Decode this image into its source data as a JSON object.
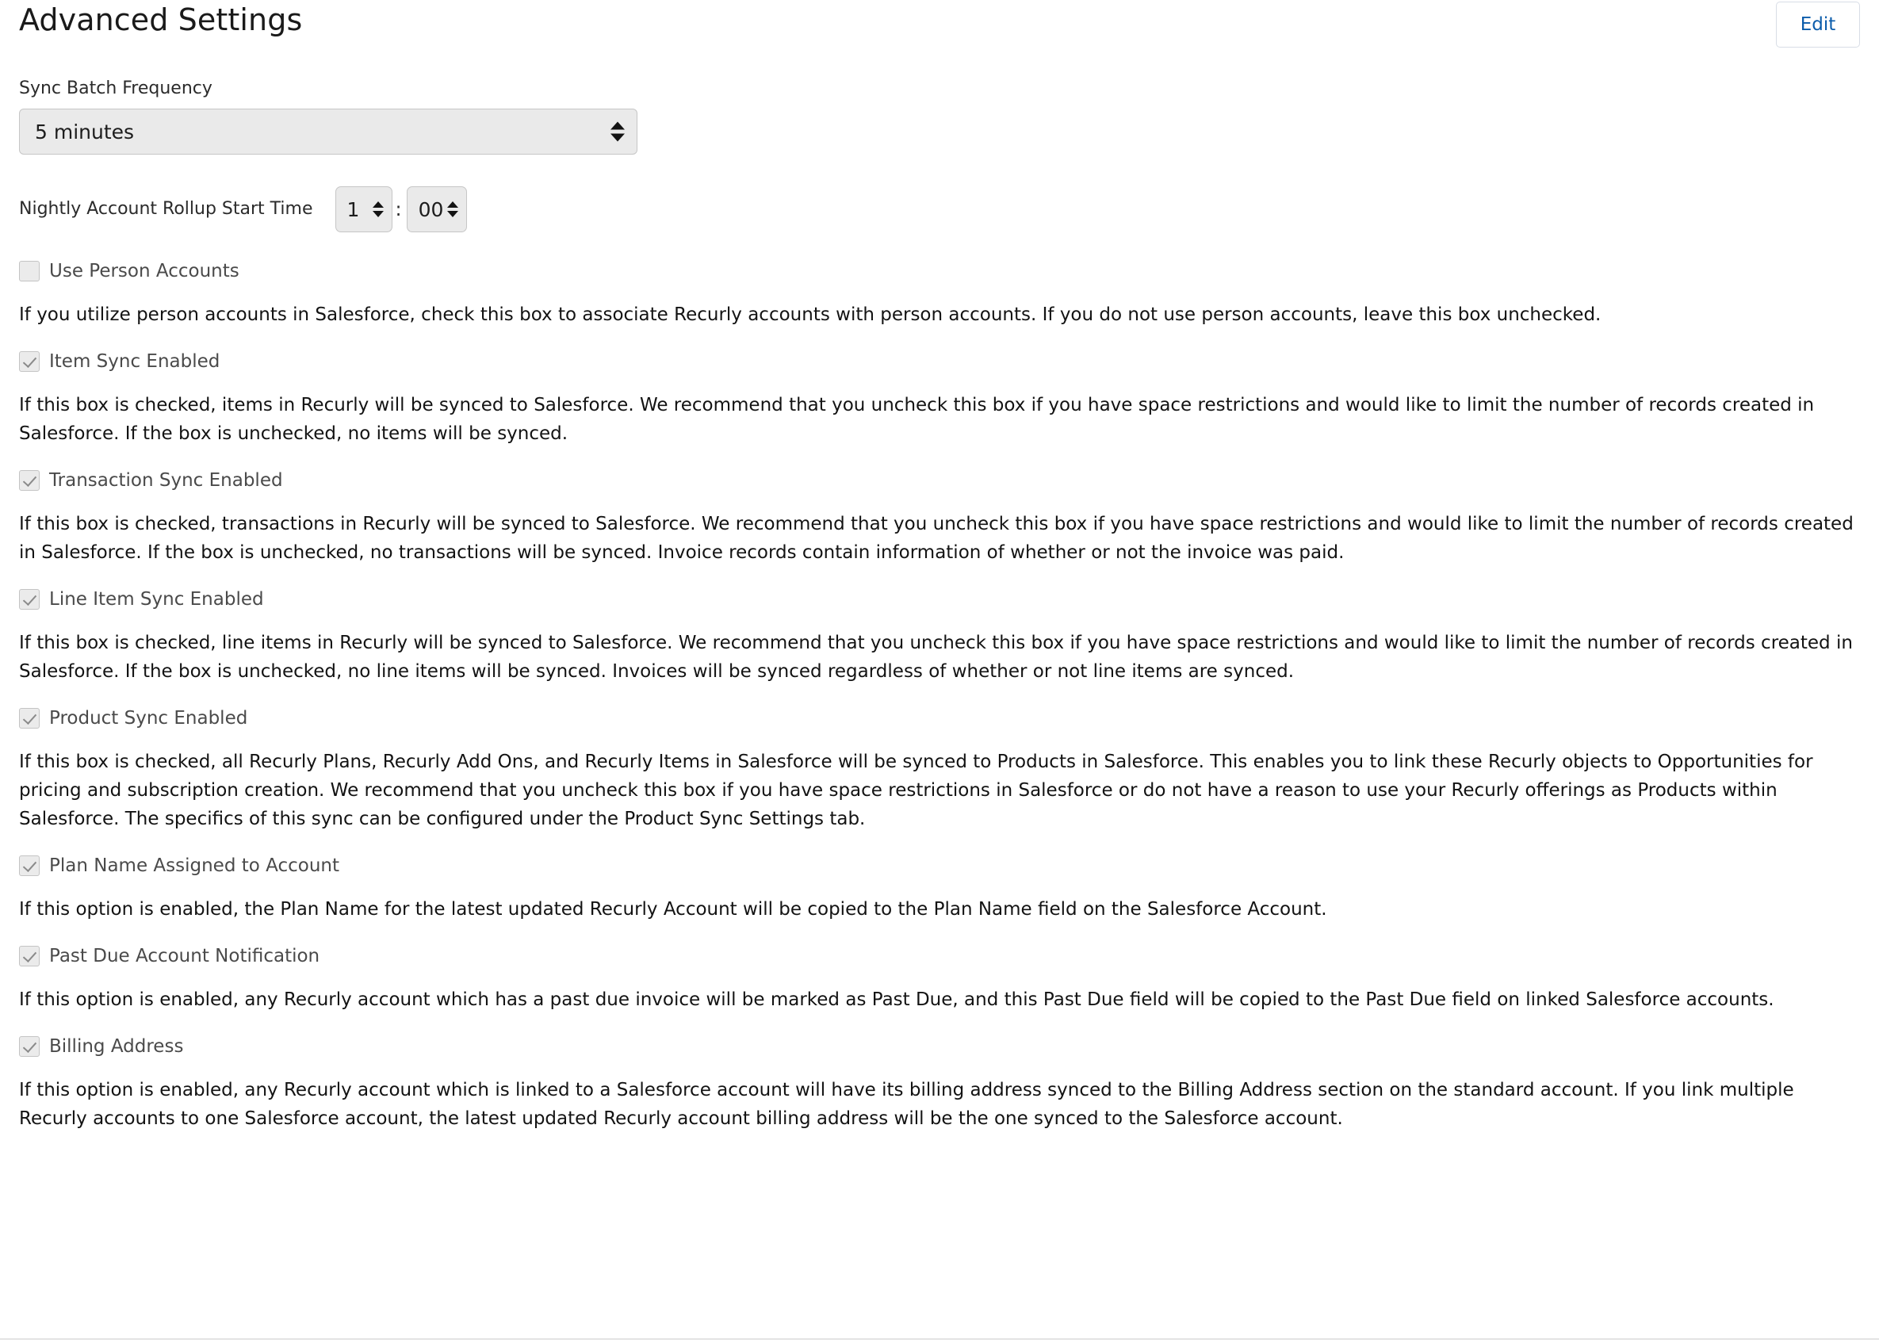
{
  "header": {
    "title": "Advanced Settings",
    "edit_label": "Edit"
  },
  "sync_batch_frequency": {
    "label": "Sync Batch Frequency",
    "value": "5 minutes"
  },
  "nightly_rollup": {
    "label": "Nightly Account Rollup Start Time",
    "hour": "1",
    "separator": ":",
    "minute": "00"
  },
  "settings": [
    {
      "name": "use-person-accounts",
      "label": "Use Person Accounts",
      "checked": false,
      "description": "If you utilize person accounts in Salesforce, check this box to associate Recurly accounts with person accounts. If you do not use person accounts, leave this box unchecked."
    },
    {
      "name": "item-sync-enabled",
      "label": "Item Sync Enabled",
      "checked": true,
      "description": "If this box is checked, items in Recurly will be synced to Salesforce. We recommend that you uncheck this box if you have space restrictions and would like to limit the number of records created in Salesforce. If the box is unchecked, no items will be synced."
    },
    {
      "name": "transaction-sync-enabled",
      "label": "Transaction Sync Enabled",
      "checked": true,
      "description": "If this box is checked, transactions in Recurly will be synced to Salesforce. We recommend that you uncheck this box if you have space restrictions and would like to limit the number of records created in Salesforce. If the box is unchecked, no transactions will be synced. Invoice records contain information of whether or not the invoice was paid."
    },
    {
      "name": "line-item-sync-enabled",
      "label": "Line Item Sync Enabled",
      "checked": true,
      "description": "If this box is checked, line items in Recurly will be synced to Salesforce. We recommend that you uncheck this box if you have space restrictions and would like to limit the number of records created in Salesforce. If the box is unchecked, no line items will be synced. Invoices will be synced regardless of whether or not line items are synced."
    },
    {
      "name": "product-sync-enabled",
      "label": "Product Sync Enabled",
      "checked": true,
      "description": "If this box is checked, all Recurly Plans, Recurly Add Ons, and Recurly Items in Salesforce will be synced to Products in Salesforce. This enables you to link these Recurly objects to Opportunities for pricing and subscription creation. We recommend that you uncheck this box if you have space restrictions in Salesforce or do not have a reason to use your Recurly offerings as Products within Salesforce. The specifics of this sync can be configured under the Product Sync Settings tab."
    },
    {
      "name": "plan-name-assigned-to-account",
      "label": "Plan Name Assigned to Account",
      "checked": true,
      "description": "If this option is enabled, the Plan Name for the latest updated Recurly Account will be copied to the Plan Name field on the Salesforce Account."
    },
    {
      "name": "past-due-account-notification",
      "label": "Past Due Account Notification",
      "checked": true,
      "description": "If this option is enabled, any Recurly account which has a past due invoice will be marked as Past Due, and this Past Due field will be copied to the Past Due field on linked Salesforce accounts."
    },
    {
      "name": "billing-address",
      "label": "Billing Address",
      "checked": true,
      "description": "If this option is enabled, any Recurly account which is linked to a Salesforce account will have its billing address synced to the Billing Address section on the standard account. If you link multiple Recurly accounts to one Salesforce account, the latest updated Recurly account billing address will be the one synced to the Salesforce account."
    }
  ],
  "colors": {
    "accent_link": "#0b5cab",
    "control_bg": "#eaeaea",
    "control_border": "#c6c6c6",
    "text_primary": "#131313",
    "label_text": "#4a4a4a"
  }
}
